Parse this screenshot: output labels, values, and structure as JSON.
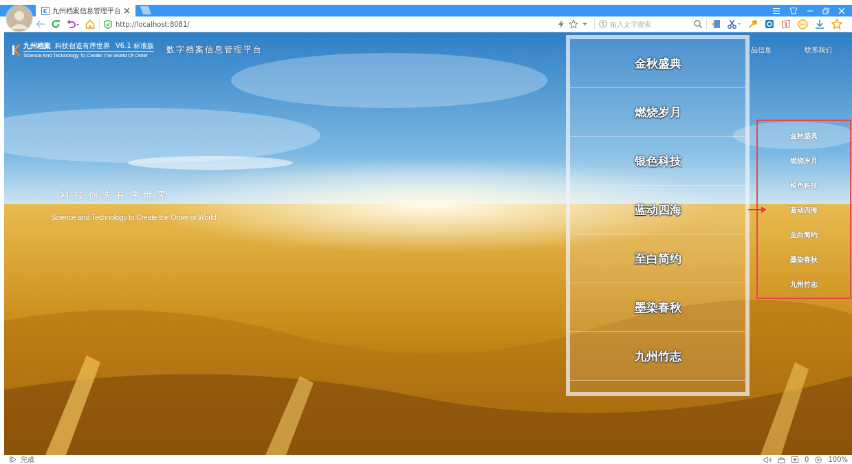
{
  "browser": {
    "tab": {
      "title": "九州档案信息管理平台",
      "selected": true
    },
    "address": "http://localhost:8081/",
    "search": {
      "placeholder": "输入文字搜索"
    }
  },
  "header": {
    "logo": {
      "name": "九州档案",
      "slogan": "科技创造有序世界",
      "english": "Science And Technology To Create The World Of Order",
      "version": "V6.1 标准版"
    },
    "title": "数字档案信息管理平台",
    "nav": [
      "品信息",
      "联系我们"
    ]
  },
  "hero": {
    "headline": "科技创造有序世界",
    "subline": "Science and Technology to Create the Order of World"
  },
  "panel": {
    "items": [
      "金秋盛典",
      "燃烧岁月",
      "银色科技",
      "蓝动四海",
      "至白简约",
      "墨染春秋",
      "九州竹志"
    ]
  },
  "side_list": {
    "items": [
      "金秋盛典",
      "燃烧岁月",
      "银色科技",
      "蓝动四海",
      "至白简约",
      "墨染春秋",
      "九州竹志"
    ]
  },
  "status_bar": {
    "status": "完成",
    "counter": "0",
    "zoom": "100%"
  }
}
